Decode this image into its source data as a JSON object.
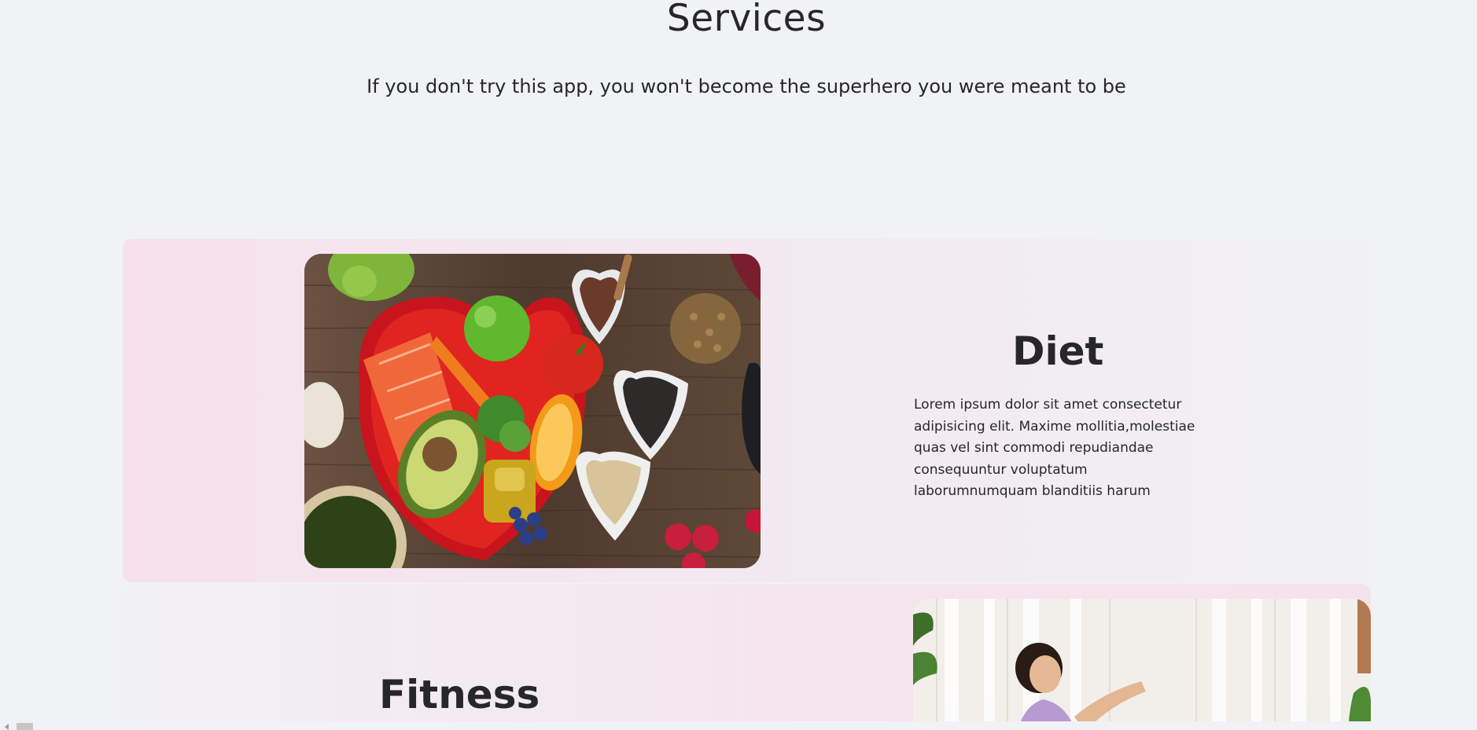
{
  "services": {
    "title": "Services",
    "subtitle": "If you don't try this app, you won't become the superhero you were meant to be"
  },
  "cards": {
    "diet": {
      "heading": "Diet",
      "text": "Lorem ipsum dolor sit amet consectetur adipisicing elit. Maxime mollitia,molestiae quas vel sint commodi repudiandae consequuntur voluptatum laborumnumquam blanditiis harum"
    },
    "fitness": {
      "heading": "Fitness"
    }
  },
  "colors": {
    "background": "#f1f2f5",
    "card_pink": "#f6e1ec",
    "text": "#26262b"
  }
}
